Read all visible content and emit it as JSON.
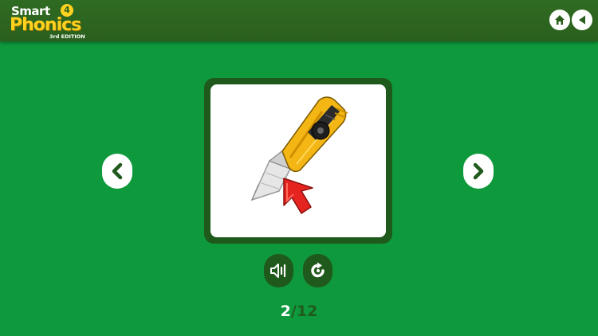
{
  "header": {
    "logo": {
      "brand_word": "Smart",
      "level": "4",
      "product": "Phonics",
      "edition": "3rd EDITION"
    },
    "home_icon": "home-icon",
    "back_icon": "triangle-left-icon"
  },
  "navigation": {
    "prev_icon": "chevron-left-icon",
    "next_icon": "chevron-right-icon"
  },
  "card": {
    "image": "utility-knife-with-red-arrow",
    "frame_color": "#1f5a1c"
  },
  "controls": {
    "sound_icon": "speaker-icon",
    "replay_icon": "replay-icon"
  },
  "pager": {
    "current": "2",
    "separator": "/",
    "total": "12"
  },
  "colors": {
    "background": "#0e9a3c",
    "topbar": "#2a5f1d",
    "accent_yellow": "#ffd21f",
    "dark_green": "#1f5a1c"
  }
}
